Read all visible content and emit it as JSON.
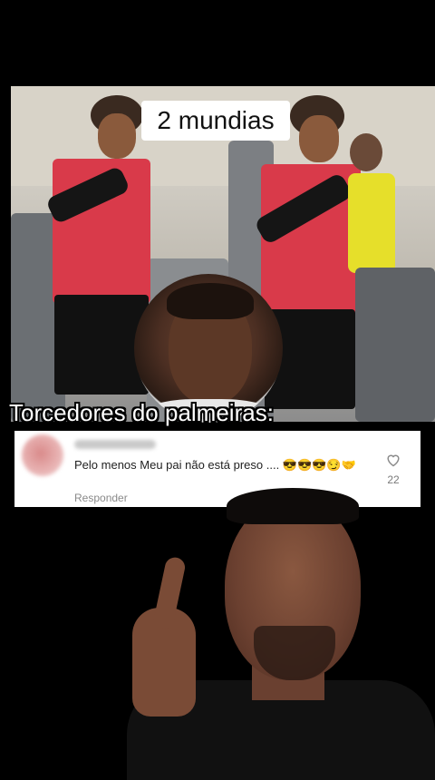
{
  "caption": "2 mundias",
  "overlay_title": "Torcedores do palmeiras:",
  "comment": {
    "text": "Pelo menos Meu pai não está preso .... 😎😎😎😏🤝",
    "reply_label": "Responder",
    "like_count": "22"
  },
  "icons": {
    "like": "heart-outline-icon"
  }
}
